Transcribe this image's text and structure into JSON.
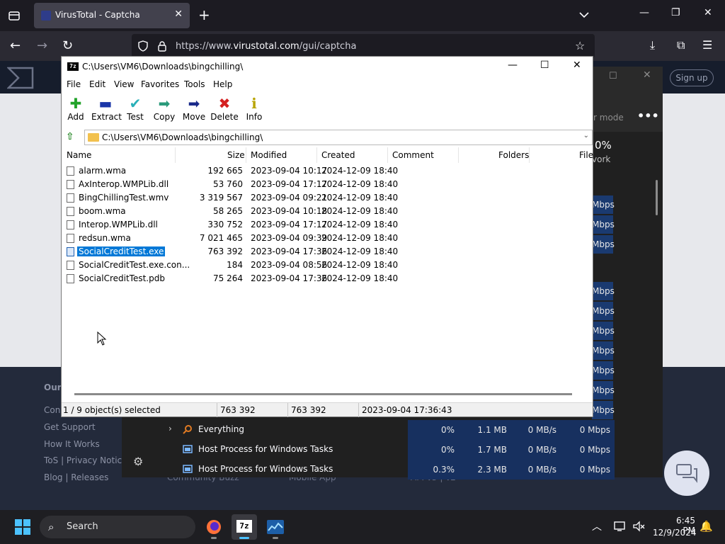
{
  "browser": {
    "tab_title": "VirusTotal - Captcha",
    "url_prefix": "https://www.",
    "url_domain": "virustotal.com",
    "url_path": "/gui/captcha"
  },
  "page": {
    "signup_label": "Sign up",
    "footer_title": "Our",
    "footer_links": [
      "Con",
      "Get Support",
      "How It Works",
      "ToS | Privacy Notic",
      "Blog | Releases"
    ],
    "footer_bottom": [
      "Community Buzz",
      "Mobile App",
      "API v3 | v2"
    ]
  },
  "taskmgr": {
    "mode_label": "r mode",
    "more_label": "•••",
    "net_pct": "0%",
    "net_label": "vork",
    "unit_cells": [
      "Mbps",
      "Mbps",
      "Mbps",
      "Mbps",
      "Mbps",
      "Mbps",
      "Mbps",
      "Mbps",
      "Mbps",
      "Mbps",
      "Mbps"
    ],
    "rows": [
      {
        "name": "Everything",
        "cpu": "0%",
        "mem": "1.1 MB",
        "disk": "0 MB/s",
        "net": "0 Mbps",
        "expandable": true
      },
      {
        "name": "Host Process for Windows Tasks",
        "cpu": "0%",
        "mem": "1.7 MB",
        "disk": "0 MB/s",
        "net": "0 Mbps",
        "expandable": false
      },
      {
        "name": "Host Process for Windows Tasks",
        "cpu": "0.3%",
        "mem": "2.3 MB",
        "disk": "0 MB/s",
        "net": "0 Mbps",
        "expandable": false
      }
    ]
  },
  "sevenzip": {
    "title": "C:\\Users\\VM6\\Downloads\\bingchilling\\",
    "icon_text": "7z",
    "menu": [
      "File",
      "Edit",
      "View",
      "Favorites",
      "Tools",
      "Help"
    ],
    "toolbar": [
      "Add",
      "Extract",
      "Test",
      "Copy",
      "Move",
      "Delete",
      "Info"
    ],
    "address": "C:\\Users\\VM6\\Downloads\\bingchilling\\",
    "columns": [
      "Name",
      "Size",
      "Modified",
      "Created",
      "Comment",
      "Folders",
      "File"
    ],
    "files": [
      {
        "name": "alarm.wma",
        "size": "192 665",
        "modified": "2023-09-04 10:17",
        "created": "2024-12-09 18:40",
        "selected": false
      },
      {
        "name": "AxInterop.WMPLib.dll",
        "size": "53 760",
        "modified": "2023-09-04 17:17",
        "created": "2024-12-09 18:40",
        "selected": false
      },
      {
        "name": "BingChillingTest.wmv",
        "size": "3 319 567",
        "modified": "2023-09-04 09:21",
        "created": "2024-12-09 18:40",
        "selected": false
      },
      {
        "name": "boom.wma",
        "size": "58 265",
        "modified": "2023-09-04 10:18",
        "created": "2024-12-09 18:40",
        "selected": false
      },
      {
        "name": "Interop.WMPLib.dll",
        "size": "330 752",
        "modified": "2023-09-04 17:17",
        "created": "2024-12-09 18:40",
        "selected": false
      },
      {
        "name": "redsun.wma",
        "size": "7 021 465",
        "modified": "2023-09-04 09:39",
        "created": "2024-12-09 18:40",
        "selected": false
      },
      {
        "name": "SocialCreditTest.exe",
        "size": "763 392",
        "modified": "2023-09-04 17:36",
        "created": "2024-12-09 18:40",
        "selected": true
      },
      {
        "name": "SocialCreditTest.exe.con...",
        "size": "184",
        "modified": "2023-09-04 08:56",
        "created": "2024-12-09 18:40",
        "selected": false
      },
      {
        "name": "SocialCreditTest.pdb",
        "size": "75 264",
        "modified": "2023-09-04 17:36",
        "created": "2024-12-09 18:40",
        "selected": false
      }
    ],
    "status": {
      "selection": "1 / 9 object(s) selected",
      "size": "763 392",
      "packed": "763 392",
      "date": "2023-09-04 17:36:43"
    }
  },
  "taskbar": {
    "search_label": "Search",
    "time": "6:45 PM",
    "date": "12/9/2024"
  },
  "colors": {
    "selection": "#0078d7",
    "taskmgr_cell": "#17305f",
    "vt_header": "#161d2c"
  }
}
